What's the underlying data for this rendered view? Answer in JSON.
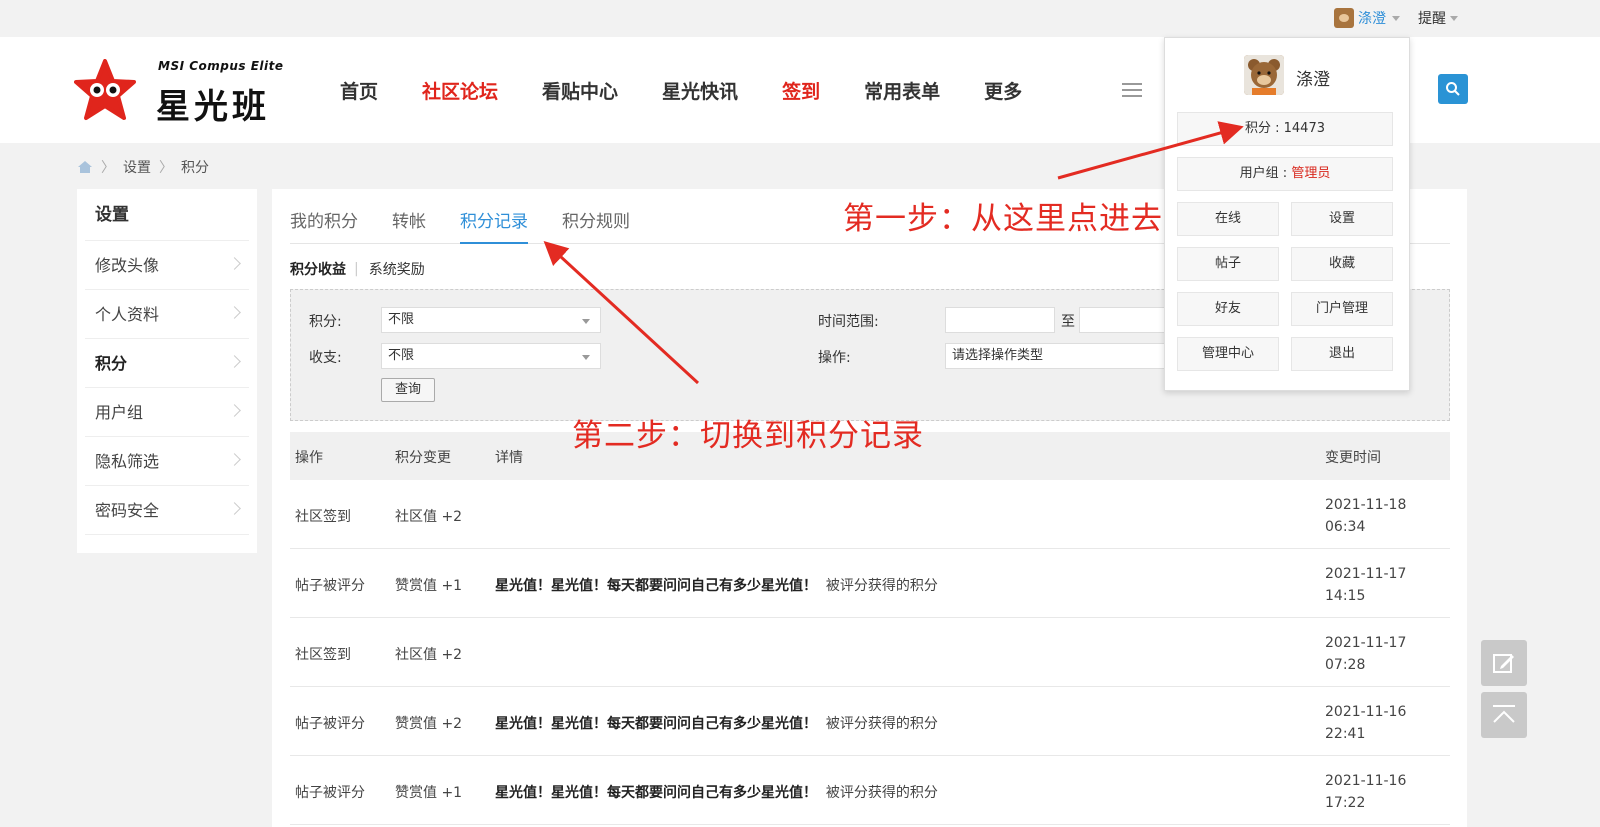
{
  "topbar": {
    "username": "涤澄",
    "remind": "提醒"
  },
  "logo": {
    "subtitle": "MSI Compus Elite",
    "title": "星光班"
  },
  "nav": {
    "items": [
      {
        "label": "首页",
        "red": false
      },
      {
        "label": "社区论坛",
        "red": true
      },
      {
        "label": "看贴中心",
        "red": false
      },
      {
        "label": "星光快讯",
        "red": false
      },
      {
        "label": "签到",
        "red": true
      },
      {
        "label": "常用表单",
        "red": false
      },
      {
        "label": "更多",
        "red": false
      }
    ]
  },
  "breadcrumb": {
    "items": [
      "设置",
      "积分"
    ]
  },
  "sidebar": {
    "title": "设置",
    "items": [
      "修改头像",
      "个人资料",
      "积分",
      "用户组",
      "隐私筛选",
      "密码安全"
    ],
    "active_index": 2
  },
  "tabs": [
    "我的积分",
    "转帐",
    "积分记录",
    "积分规则"
  ],
  "active_tab": 2,
  "subtabs": {
    "active": "积分收益",
    "other": "系统奖励"
  },
  "filter": {
    "points_label": "积分:",
    "points_value": "不限",
    "inout_label": "收支:",
    "inout_value": "不限",
    "query_button": "查询",
    "time_label": "时间范围:",
    "time_to": "至",
    "op_label": "操作:",
    "op_placeholder": "请选择操作类型"
  },
  "table": {
    "headers": [
      "操作",
      "积分变更",
      "详情",
      "变更时间"
    ],
    "rows": [
      {
        "op": "社区签到",
        "change": "社区值 +2",
        "detail_bold": "",
        "detail": "",
        "date": "2021-11-18",
        "time": "06:34"
      },
      {
        "op": "帖子被评分",
        "change": "赞赏值 +1",
        "detail_bold": "星光值！星光值！每天都要问问自己有多少星光值！",
        "detail": "被评分获得的积分",
        "date": "2021-11-17",
        "time": "14:15"
      },
      {
        "op": "社区签到",
        "change": "社区值 +2",
        "detail_bold": "",
        "detail": "",
        "date": "2021-11-17",
        "time": "07:28"
      },
      {
        "op": "帖子被评分",
        "change": "赞赏值 +2",
        "detail_bold": "星光值！星光值！每天都要问问自己有多少星光值！",
        "detail": "被评分获得的积分",
        "date": "2021-11-16",
        "time": "22:41"
      },
      {
        "op": "帖子被评分",
        "change": "赞赏值 +1",
        "detail_bold": "星光值！星光值！每天都要问问自己有多少星光值！",
        "detail": "被评分获得的积分",
        "date": "2021-11-16",
        "time": "17:22"
      }
    ]
  },
  "user_panel": {
    "name": "涤澄",
    "points": "积分 : 14473",
    "group_label": "用户组 : ",
    "group_value": "管理员",
    "buttons": [
      "在线",
      "设置",
      "帖子",
      "收藏",
      "好友",
      "门户管理",
      "管理中心",
      "退出"
    ]
  },
  "annotations": {
    "step1": "第一步：从这里点进去",
    "step2": "第二步：切换到积分记录"
  },
  "colors": {
    "accent": "#2f8fd8",
    "red": "#e0251c",
    "annotation": "#e32b22"
  }
}
